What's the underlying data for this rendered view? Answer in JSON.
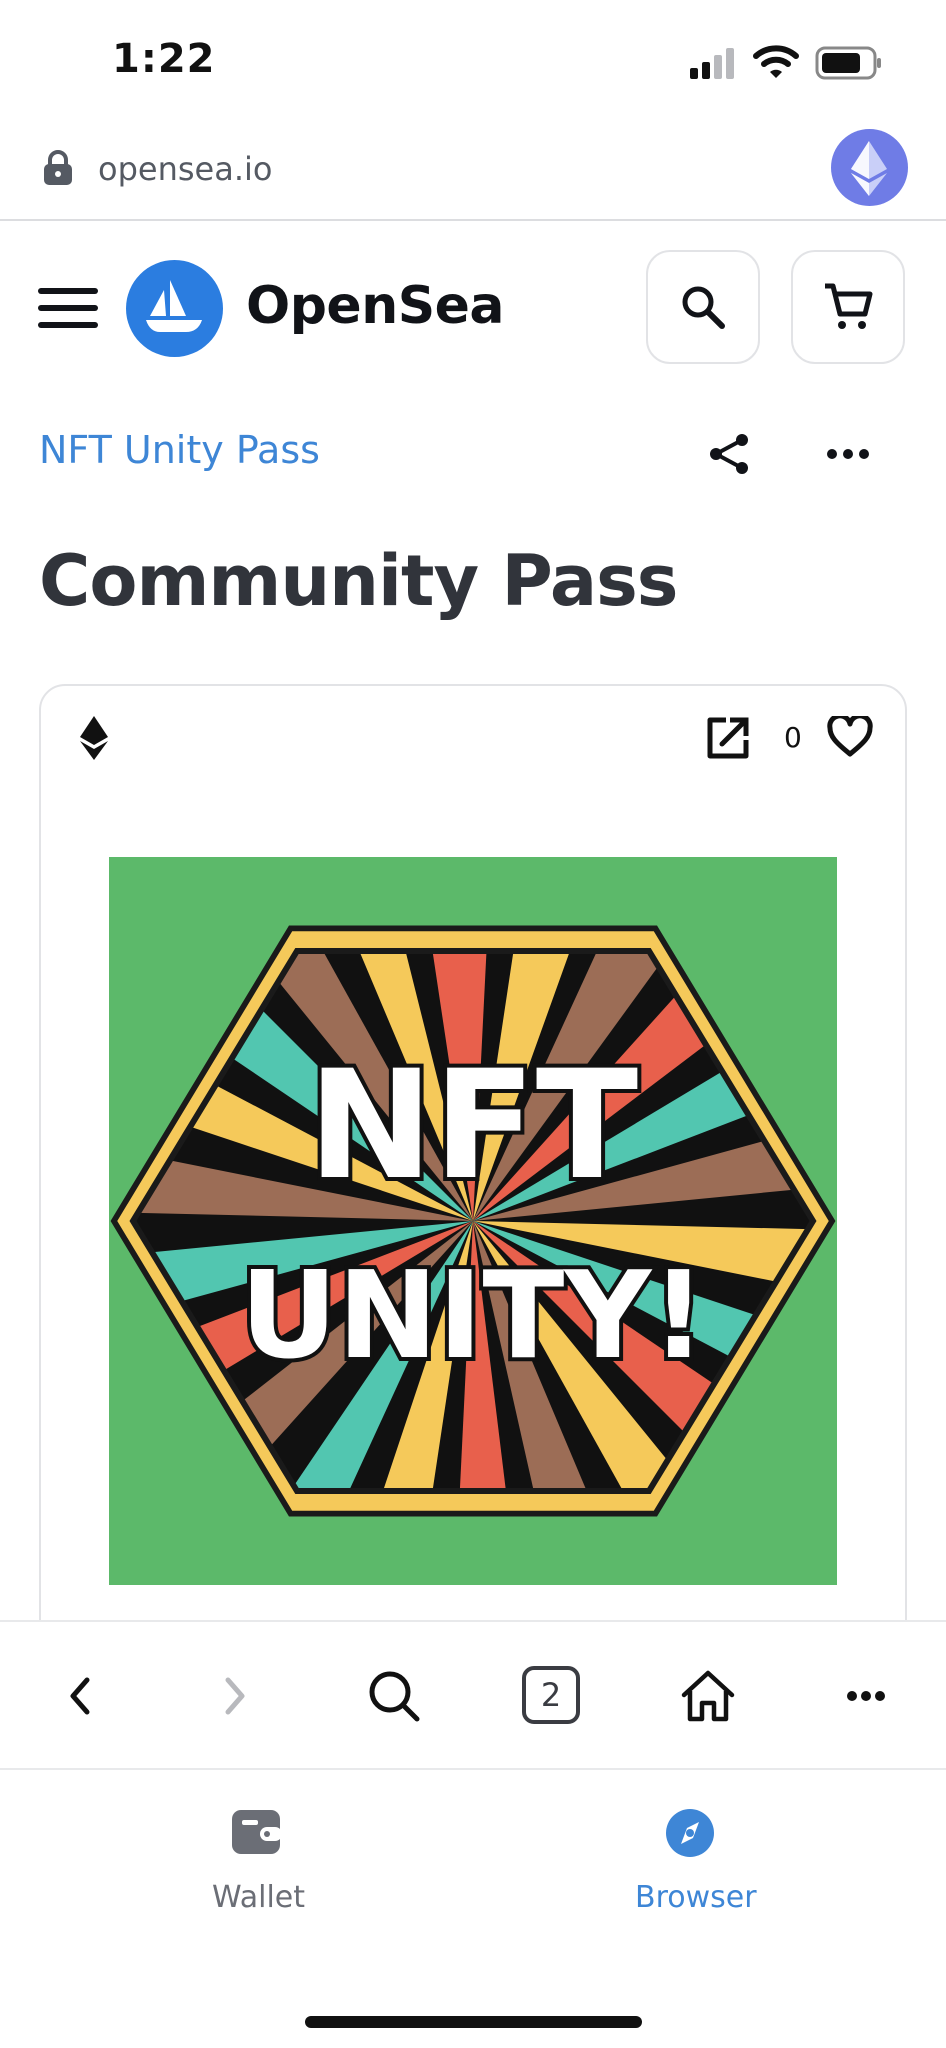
{
  "status_bar": {
    "time": "1:22"
  },
  "url_bar": {
    "url": "opensea.io"
  },
  "header": {
    "brand": "OpenSea"
  },
  "collection": {
    "name": "NFT Unity Pass"
  },
  "item": {
    "title": "Community Pass",
    "favorites_count": "0"
  },
  "nft_art": {
    "line1": "NFT",
    "line2": "UNITY!"
  },
  "browser_toolbar": {
    "tabs_count": "2"
  },
  "tab_bar": {
    "wallet_label": "Wallet",
    "browser_label": "Browser"
  },
  "colors": {
    "accent_blue": "#3e86d6",
    "opensea_blue": "#2b7de0",
    "eth_purple": "#6f7ce6",
    "nft_background": "#5cb96a"
  }
}
